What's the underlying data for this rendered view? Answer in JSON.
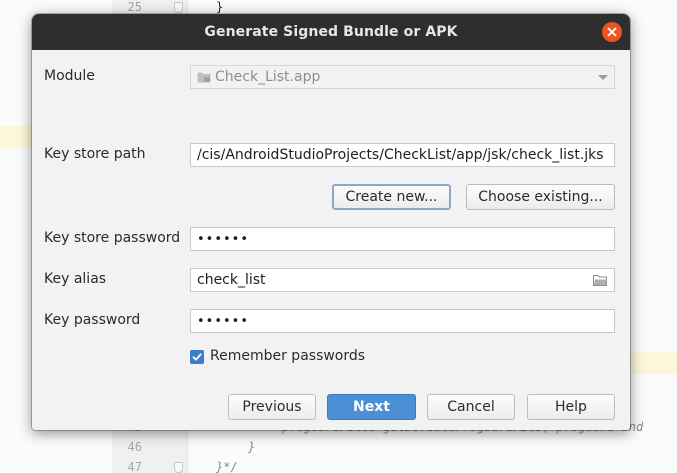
{
  "editor": {
    "lines": [
      {
        "num": "25",
        "text": "}",
        "style": "normal"
      },
      {
        "num": "45",
        "text": "proguardFiles getDefaultProguardFile('proguard-and",
        "style": "dim"
      },
      {
        "num": "46",
        "text": "}",
        "style": "dim"
      },
      {
        "num": "47",
        "text": "}*/",
        "style": "dim"
      }
    ]
  },
  "dialog": {
    "title": "Generate Signed Bundle or APK",
    "module": {
      "label": "Module",
      "value": "Check_List.app"
    },
    "keystore_path": {
      "label": "Key store path",
      "value": "/cis/AndroidStudioProjects/CheckList/app/jsk/check_list.jks"
    },
    "create_new_label": "Create new...",
    "choose_existing_label": "Choose existing...",
    "keystore_password": {
      "label": "Key store password",
      "value": "••••••"
    },
    "key_alias": {
      "label": "Key alias",
      "value": "check_list"
    },
    "key_password": {
      "label": "Key password",
      "value": "••••••"
    },
    "remember": {
      "label": "Remember passwords",
      "checked": true
    },
    "buttons": {
      "previous": "Previous",
      "next": "Next",
      "cancel": "Cancel",
      "help": "Help"
    }
  },
  "colors": {
    "titlebar": "#2e2e2e",
    "close": "#e95420",
    "primary": "#4b8fd5",
    "checkbox": "#3d7cc9"
  },
  "icons": [
    "close-icon",
    "folder-icon",
    "chevron-down-icon",
    "browse-folder-icon",
    "checkmark-icon"
  ]
}
